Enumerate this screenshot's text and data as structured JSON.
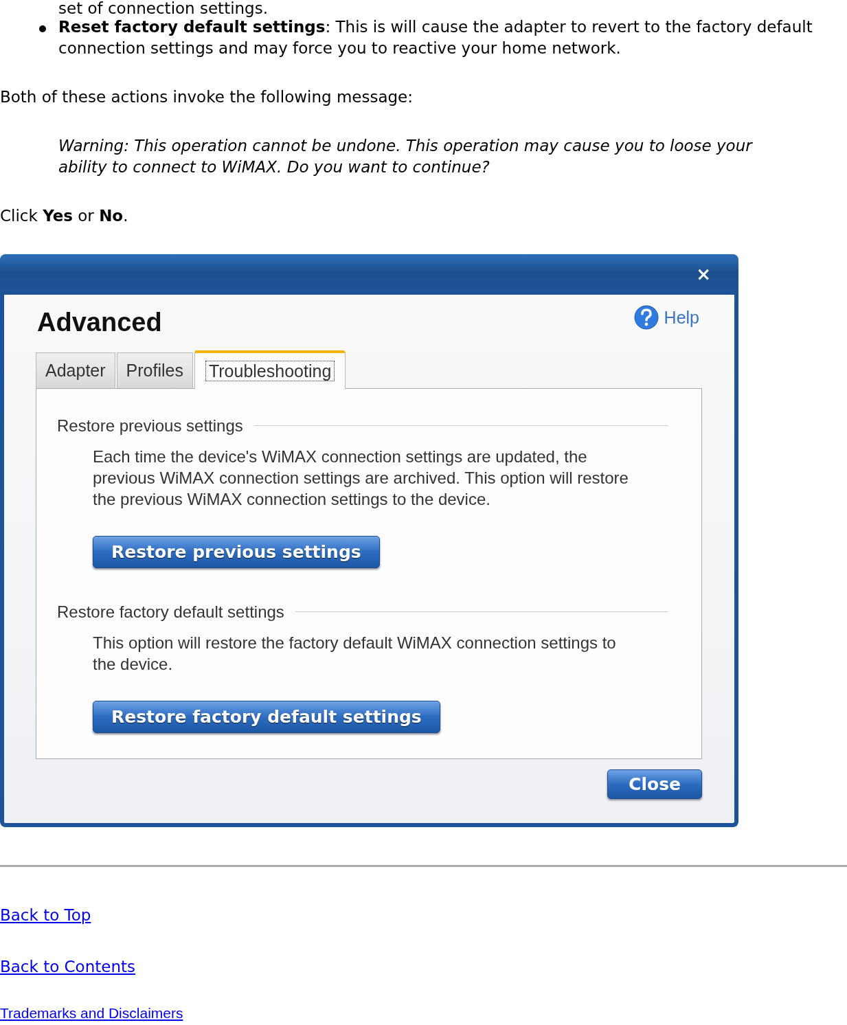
{
  "intro_fragment": "set of connection settings.",
  "bullets": [
    "**Reset factory default settings**: This is will cause the adapter to revert to the factory default connection settings and may force you to reactive your home network."
  ],
  "message_intro": "Both of these actions invoke the following message:",
  "warning": "Warning: This operation cannot be undone. This operation may cause you to loose your ability to connect to WiMAX. Do you want to continue?",
  "instruction": "Click **Yes** or **No**.",
  "dialog": {
    "close_glyph": "×",
    "title": "Advanced",
    "help": "Help",
    "tabs": [
      {
        "label": "Adapter",
        "selected": false
      },
      {
        "label": "Profiles",
        "selected": false
      },
      {
        "label": "Troubleshooting",
        "selected": true
      }
    ],
    "sections": [
      {
        "heading": "Restore previous settings",
        "text": "Each time the device's WiMAX connection settings are updated, the previous WiMAX connection settings are archived.   This option will restore the previous WiMAX connection settings to the device.",
        "button": "Restore previous settings"
      },
      {
        "heading": "Restore factory default settings",
        "text": "This option will restore the factory default WiMAX connection settings to the device.",
        "button": "Restore factory default settings"
      }
    ],
    "close_button": "Close"
  },
  "links": [
    "Back to Top",
    "Back to Contents"
  ],
  "footer_link": "Trademarks and Disclaimers"
}
